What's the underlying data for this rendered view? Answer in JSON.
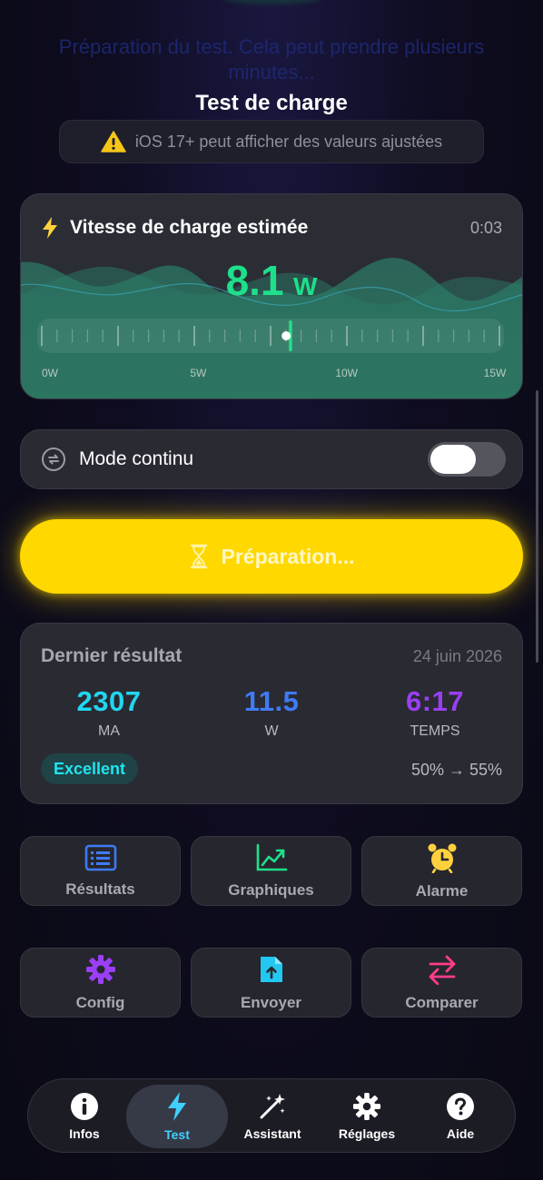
{
  "background_text": "Préparation du test. Cela peut prendre plusieurs minutes...",
  "header": {
    "title": "Test de charge",
    "warning": "iOS 17+ peut afficher des valeurs ajustées",
    "warning_icon": "warning-triangle-icon"
  },
  "speed_card": {
    "icon": "bolt-icon",
    "label": "Vitesse de charge estimée",
    "timer": "0:03",
    "value": "8.1",
    "unit": "W",
    "gauge_min": 0,
    "gauge_max": 15,
    "gauge_value": 8.1,
    "gauge_labels": [
      "0W",
      "5W",
      "10W",
      "15W"
    ],
    "accent_color": "#1ee08a"
  },
  "continuous_mode": {
    "icon": "repeat-circle-icon",
    "label": "Mode continu",
    "enabled": false
  },
  "prep_button": {
    "icon": "hourglass-icon",
    "label": "Préparation...",
    "color": "#ffd800"
  },
  "last_result": {
    "title": "Dernier résultat",
    "date": "24 juin 2026",
    "stats": [
      {
        "value": "2307",
        "unit": "MA",
        "color": "#22d6f0"
      },
      {
        "value": "11.5",
        "unit": "W",
        "color": "#3f7bf5"
      },
      {
        "value": "6:17",
        "unit": "TEMPS",
        "color": "#9a3ff5"
      }
    ],
    "rating": "Excellent",
    "range": "50% → 55%"
  },
  "actions": [
    {
      "label": "Résultats",
      "icon": "list-doc-icon",
      "color": "#3d7cf5"
    },
    {
      "label": "Graphiques",
      "icon": "chart-up-icon",
      "color": "#1ee08a"
    },
    {
      "label": "Alarme",
      "icon": "alarm-clock-icon",
      "color": "#ffd23d"
    },
    {
      "label": "Config",
      "icon": "gear-icon",
      "color": "#9a3ff5"
    },
    {
      "label": "Envoyer",
      "icon": "upload-doc-icon",
      "color": "#22c8f0"
    },
    {
      "label": "Comparer",
      "icon": "swap-arrows-icon",
      "color": "#ff3d8b"
    }
  ],
  "tabs": [
    {
      "label": "Infos",
      "icon": "info-icon"
    },
    {
      "label": "Test",
      "icon": "bolt-icon",
      "active": true
    },
    {
      "label": "Assistant",
      "icon": "magic-wand-icon"
    },
    {
      "label": "Réglages",
      "icon": "gear-icon"
    },
    {
      "label": "Aide",
      "icon": "question-icon"
    }
  ]
}
